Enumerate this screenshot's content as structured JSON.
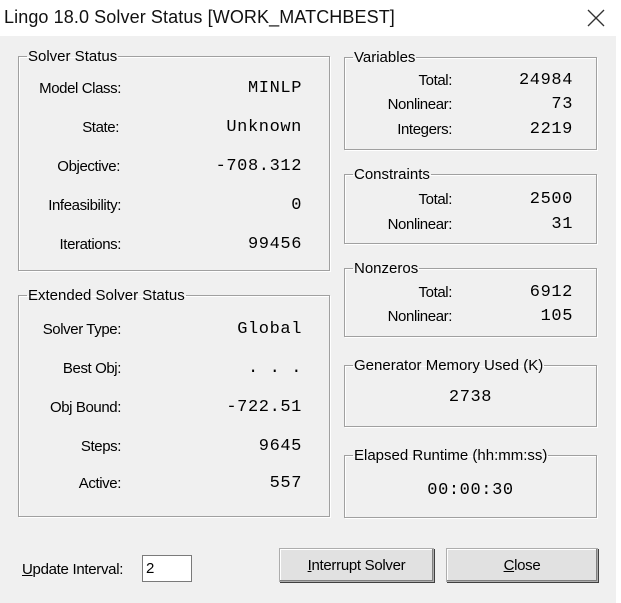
{
  "window": {
    "title": "Lingo 18.0 Solver Status [WORK_MATCHBEST]"
  },
  "solver_status": {
    "legend": "Solver Status",
    "rows": [
      {
        "label": "Model Class:",
        "value": "MINLP"
      },
      {
        "label": "State:",
        "value": "Unknown"
      },
      {
        "label": "Objective:",
        "value": "-708.312"
      },
      {
        "label": "Infeasibility:",
        "value": "0"
      },
      {
        "label": "Iterations:",
        "value": "99456"
      }
    ]
  },
  "extended_status": {
    "legend": "Extended Solver Status",
    "rows": [
      {
        "label": "Solver Type:",
        "value": "Global"
      },
      {
        "label": "Best Obj:",
        "value": ". . ."
      },
      {
        "label": "Obj Bound:",
        "value": "-722.51"
      },
      {
        "label": "Steps:",
        "value": "9645"
      },
      {
        "label": "Active:",
        "value": "557"
      }
    ]
  },
  "variables": {
    "legend": "Variables",
    "rows": [
      {
        "label": "Total:",
        "value": "24984"
      },
      {
        "label": "Nonlinear:",
        "value": "73"
      },
      {
        "label": "Integers:",
        "value": "2219"
      }
    ]
  },
  "constraints": {
    "legend": "Constraints",
    "rows": [
      {
        "label": "Total:",
        "value": "2500"
      },
      {
        "label": "Nonlinear:",
        "value": "31"
      }
    ]
  },
  "nonzeros": {
    "legend": "Nonzeros",
    "rows": [
      {
        "label": "Total:",
        "value": "6912"
      },
      {
        "label": "Nonlinear:",
        "value": "105"
      }
    ]
  },
  "generator_memory": {
    "legend": "Generator Memory Used (K)",
    "value": "2738"
  },
  "elapsed_runtime": {
    "legend": "Elapsed Runtime (hh:mm:ss)",
    "value": "00:00:30"
  },
  "update_interval": {
    "label_underlined": "U",
    "label_rest": "pdate Interval:",
    "value": "2"
  },
  "buttons": {
    "interrupt_underlined": "I",
    "interrupt_rest": "nterrupt Solver",
    "close_underlined": "C",
    "close_rest": "lose"
  }
}
